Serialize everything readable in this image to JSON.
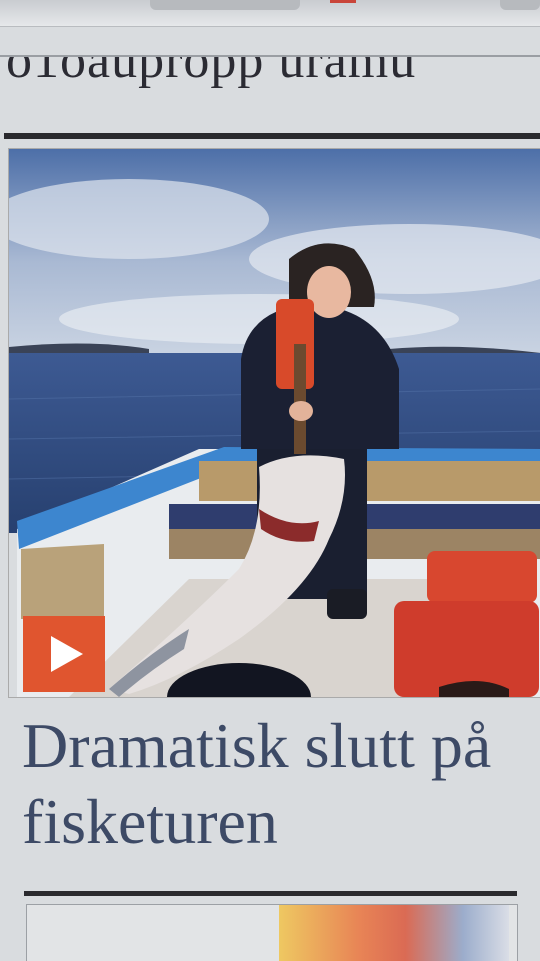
{
  "previous_article": {
    "headline_fragment": "o1oaupropp  uramu"
  },
  "article": {
    "headline": "Dramatisk slutt på fisketuren",
    "media": {
      "play_icon": "play-icon",
      "accent_color": "#e0552f"
    }
  },
  "colors": {
    "headline_text": "#3d4a66",
    "rule": "#2a2a2e",
    "page_background": "#d9dcdf"
  }
}
